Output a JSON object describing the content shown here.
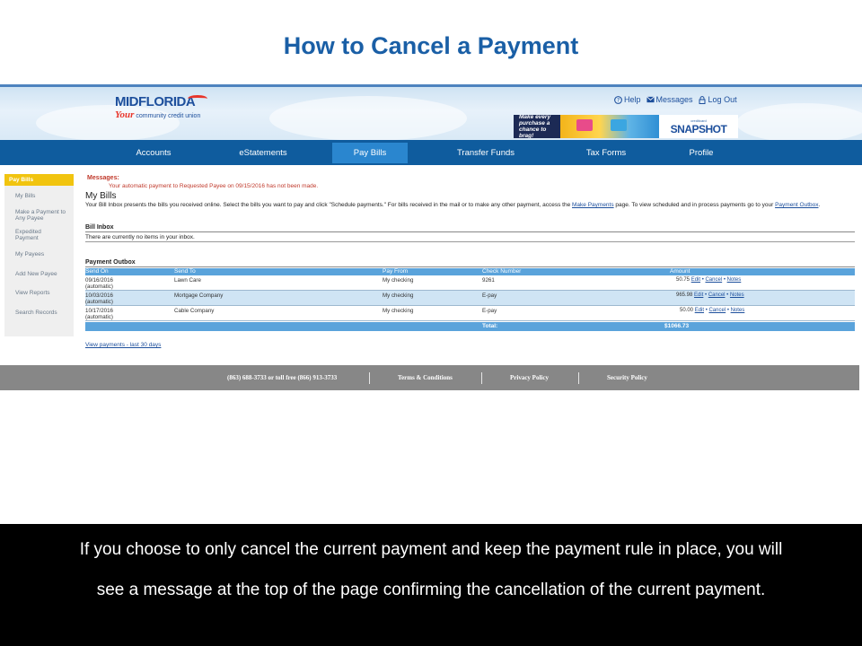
{
  "slide": {
    "title": "How to Cancel a Payment",
    "caption_lines": [
      "If you choose to only cancel the current payment and keep the payment rule in place, you will",
      "see a message at the top of the page confirming the cancellation of the current payment."
    ]
  },
  "colors": {
    "title_blue": "#1a5fa6",
    "nav_blue": "#0f5c9e",
    "nav_active": "#2a86cf",
    "sidebar_active": "#f1c40f",
    "message_red": "#c0392b",
    "table_header": "#5aa3db",
    "footer_gray": "#878787"
  },
  "header": {
    "logo_top": "MIDFLORIDA",
    "logo_your": "Your",
    "logo_sub": "community credit union",
    "links": [
      {
        "label": "Help",
        "icon": "help-icon"
      },
      {
        "label": "Messages",
        "icon": "mail-icon"
      },
      {
        "label": "Log Out",
        "icon": "lock-icon"
      }
    ],
    "banner": {
      "text": "Make every purchase a chance to brag!",
      "small": "creditcard",
      "brand": "SNAPSHOT"
    }
  },
  "nav": {
    "items": [
      "Accounts",
      "eStatements",
      "Pay Bills",
      "Transfer Funds",
      "Tax Forms",
      "Profile"
    ],
    "active": "Pay Bills"
  },
  "sidebar": {
    "items": [
      "Pay Bills",
      "My Bills",
      "Make a Payment to Any Payee",
      "Expedited Payment",
      "My Payees",
      "Add New Payee",
      "View Reports",
      "Search Records"
    ]
  },
  "main": {
    "messages_label": "Messages:",
    "message": "Your automatic payment to Requested Payee on 09/15/2016 has not been made.",
    "heading": "My Bills",
    "intro_a": "Your Bill Inbox presents the bills you received online. Select the bills you want to pay and click \"Schedule payments.\" For bills received in the mail or to make any other payment, access the ",
    "intro_link1": "Make Payments",
    "intro_b": " page. To view scheduled and in process payments go to your ",
    "intro_link2": "Payment Outbox",
    "intro_c": ".",
    "bill_inbox_title": "Bill Inbox",
    "bill_inbox_empty": "There are currently no items in your inbox.",
    "outbox_title": "Payment Outbox",
    "columns": [
      "Send On",
      "Send To",
      "Pay From",
      "Check Number",
      "Amount"
    ],
    "rows": [
      {
        "date": "09/16/2016",
        "note": "(automatic)",
        "payee": "Lawn Care",
        "from": "My checking",
        "check": "9261",
        "amount": "50.75"
      },
      {
        "date": "10/03/2016",
        "note": "(automatic)",
        "payee": "Mortgage Company",
        "from": "My checking",
        "check": "E-pay",
        "amount": "965.98"
      },
      {
        "date": "10/17/2016",
        "note": "(automatic)",
        "payee": "Cable Company",
        "from": "My checking",
        "check": "E-pay",
        "amount": "50.00"
      }
    ],
    "actions": {
      "edit": "Edit",
      "cancel": "Cancel",
      "notes": "Notes",
      "sep": " • "
    },
    "total_label": "Total:",
    "total_value": "$1066.73",
    "view_link": "View payments - last 30 days"
  },
  "footer": {
    "items": [
      "(863) 688-3733 or toll free (866) 913-3733",
      "Terms & Conditions",
      "Privacy Policy",
      "Security Policy"
    ]
  }
}
